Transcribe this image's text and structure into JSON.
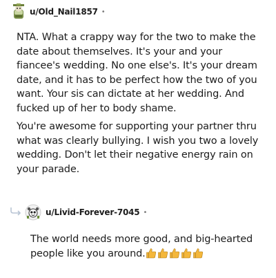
{
  "comment": {
    "username": "u/Old_Nail1857",
    "separator": "•",
    "paragraphs": [
      "NTA. What a crappy way for the two to make the date about themselves. It's your and your fiancee's wedding. No one else's. It's your dream date, and it has to be perfect how the two of you want. Your sis can dictate at her wedding. And fucked up of her to body shame.",
      "You're awesome for supporting your partner thru what was clearly bullying. I wish you two a lovely wedding. Don't let their negative energy rain on your parade."
    ]
  },
  "reply": {
    "username": "u/Livid-Forever-7045",
    "separator": "•",
    "text": "The world needs more good, and big-hearted people like you around.",
    "emoji": "👍👍👍👍👍",
    "emoji_count": 5
  },
  "colors": {
    "text": "#1c1c1c",
    "meta": "#7c7c7c",
    "thumb": "#f4b73b"
  }
}
